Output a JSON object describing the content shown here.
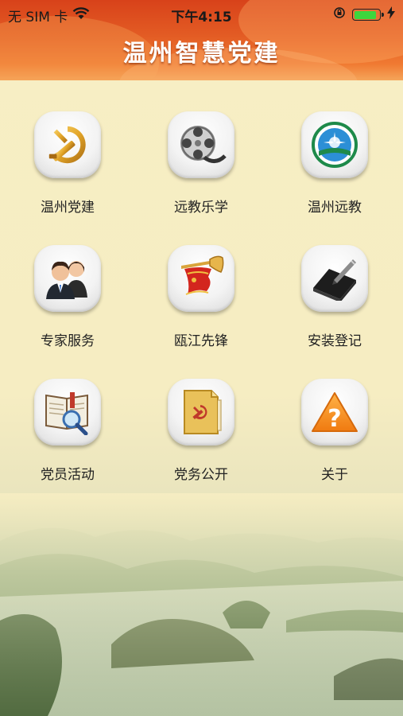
{
  "status_bar": {
    "carrier": "无 SIM 卡",
    "time": "下午4:15",
    "battery_level": 0.9
  },
  "header": {
    "title": "温州智慧党建"
  },
  "menu": {
    "items": [
      {
        "label": "温州党建",
        "icon": "party-emblem-icon"
      },
      {
        "label": "远教乐学",
        "icon": "film-reel-icon"
      },
      {
        "label": "温州远教",
        "icon": "remote-education-logo-icon"
      },
      {
        "label": "专家服务",
        "icon": "experts-icon"
      },
      {
        "label": "瓯江先锋",
        "icon": "bugle-flag-icon"
      },
      {
        "label": "安装登记",
        "icon": "tablet-pen-icon"
      },
      {
        "label": "党员活动",
        "icon": "book-magnifier-icon"
      },
      {
        "label": "党务公开",
        "icon": "party-folder-icon"
      },
      {
        "label": "关于",
        "icon": "warning-question-icon"
      }
    ]
  },
  "colors": {
    "header_red": "#d8421a",
    "background": "#f7eec4",
    "party_gold": "#e3a62a"
  }
}
